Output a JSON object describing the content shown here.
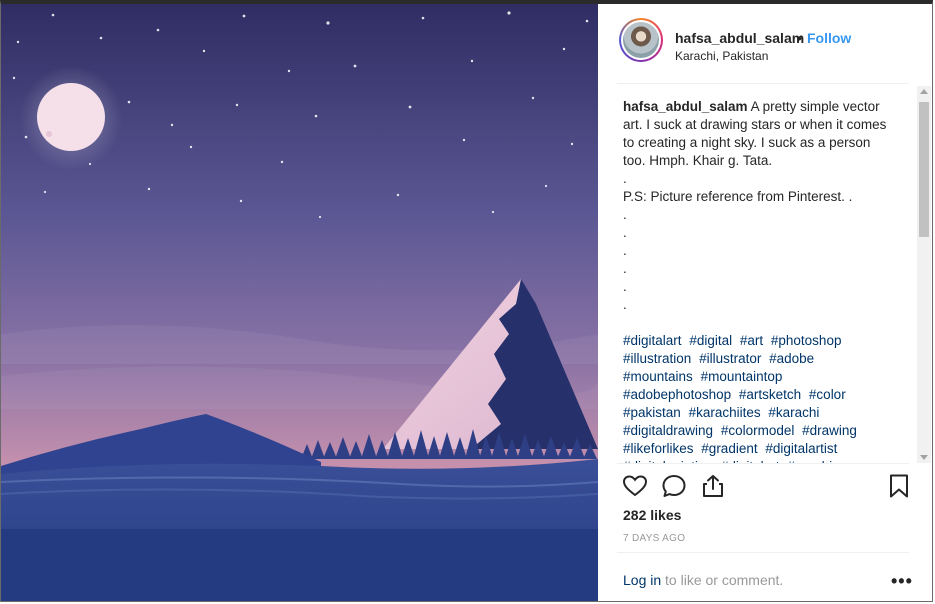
{
  "post": {
    "username": "hafsa_abdul_salam",
    "separator": "•",
    "follow_label": "Follow",
    "location": "Karachi, Pakistan",
    "caption_user": "hafsa_abdul_salam",
    "caption_text": " A pretty simple vector art. I suck at drawing stars or when it comes to creating a night sky. I suck as a person too. Hmph. Khair g. Tata.\n.\nP.S: Picture reference from Pinterest. .\n.\n.\n.\n.\n.\n.",
    "hashtags": [
      "#digitalart",
      "#digital",
      "#art",
      "#photoshop",
      "#illustration",
      "#illustrator",
      "#adobe",
      "#mountains",
      "#mountaintop",
      "#adobephotoshop",
      "#artsketch",
      "#color",
      "#pakistan",
      "#karachiites",
      "#karachi",
      "#digitaldrawing",
      "#colormodel",
      "#drawing",
      "#likeforlikes",
      "#gradient",
      "#digitalartist",
      "#digitalpainting",
      "#digitalart",
      "#graphic"
    ],
    "likes": "282 likes",
    "time": "7 DAYS AGO",
    "login_link": "Log in",
    "login_rest": " to like or comment.",
    "more": "•••"
  },
  "icons": {
    "like": "heart-icon",
    "comment": "comment-icon",
    "share": "share-icon",
    "save": "bookmark-icon"
  },
  "colors": {
    "follow": "#3897f0",
    "hashtag": "#003569",
    "sky_top": "#3e3a73",
    "sky_bottom": "#d8a0b8"
  }
}
